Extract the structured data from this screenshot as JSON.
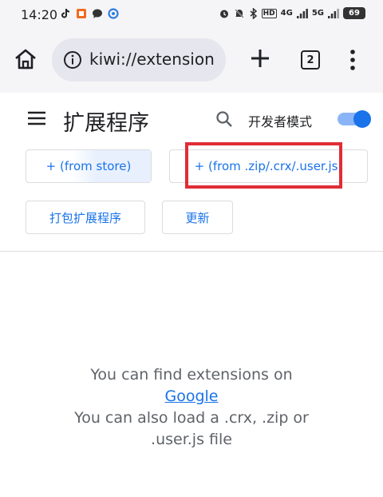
{
  "status_bar": {
    "time": "14:20",
    "network_4g": "4G",
    "network_5g": "5G",
    "hd_badge": "HD",
    "battery": "69"
  },
  "browser": {
    "url": "kiwi://extension",
    "tab_count": "2"
  },
  "extensions_page": {
    "title": "扩展程序",
    "developer_mode_label": "开发者模式",
    "developer_mode_enabled": true,
    "buttons": {
      "from_store": "+ (from store)",
      "from_zip": "+ (from .zip/.crx/.user.js)",
      "pack": "打包扩展程序",
      "update": "更新"
    },
    "empty_state": {
      "line1": "You can find extensions on",
      "link": "Google",
      "line2": "You can also load a .crx, .zip or",
      "line3": ".user.js file"
    }
  },
  "colors": {
    "accent": "#1a73e8",
    "highlight": "#e02d36",
    "toolbar_bg": "#f5f5f7",
    "url_bg": "#e6e6ee"
  }
}
